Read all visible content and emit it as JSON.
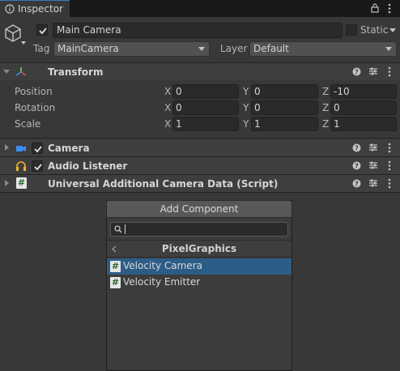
{
  "tab": {
    "label": "Inspector"
  },
  "object": {
    "active": true,
    "name": "Main Camera",
    "static_label": "Static",
    "static": false,
    "tag_label": "Tag",
    "tag_value": "MainCamera",
    "layer_label": "Layer",
    "layer_value": "Default"
  },
  "transform": {
    "title": "Transform",
    "rows": [
      {
        "label": "Position",
        "x": "0",
        "y": "0",
        "z": "-10"
      },
      {
        "label": "Rotation",
        "x": "0",
        "y": "0",
        "z": "0"
      },
      {
        "label": "Scale",
        "x": "1",
        "y": "1",
        "z": "1"
      }
    ],
    "axis_x": "X",
    "axis_y": "Y",
    "axis_z": "Z"
  },
  "components": [
    {
      "title": "Camera",
      "enabled": true,
      "icon": "camera-icon"
    },
    {
      "title": "Audio Listener",
      "enabled": true,
      "icon": "headphones-icon"
    },
    {
      "title": "Universal Additional Camera Data (Script)",
      "icon": "script-icon"
    }
  ],
  "add_component": {
    "button_label": "Add Component",
    "search_value": "",
    "category": "PixelGraphics",
    "items": [
      {
        "label": "Velocity Camera",
        "selected": true
      },
      {
        "label": "Velocity Emitter",
        "selected": false
      }
    ]
  },
  "colors": {
    "panel": "#383838",
    "selection": "#2c5d87",
    "accent": "#3a79bb"
  }
}
